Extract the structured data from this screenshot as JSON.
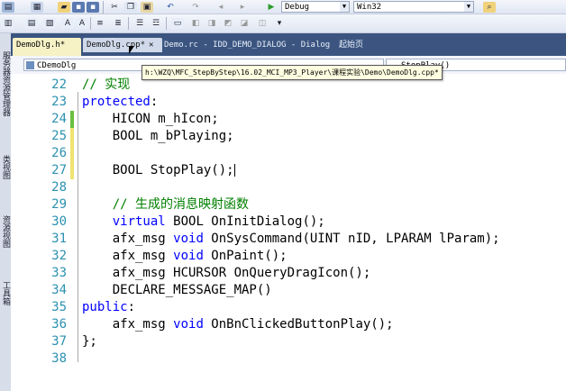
{
  "toolbar": {
    "config_value": "Debug",
    "platform_value": "Win32"
  },
  "sidebar": {
    "tabs": [
      "服务器资源管理器",
      "类视图",
      "资源视图",
      "工具箱"
    ]
  },
  "tabs": [
    {
      "label": "DemoDlg.h*",
      "state": "active"
    },
    {
      "label": "DemoDlg.cpp*",
      "state": "inactive2"
    },
    {
      "label": "Demo.rc - IDD_DEMO_DIALOG - Dialog",
      "state": "inactive"
    },
    {
      "label": "起始页",
      "state": "inactive"
    }
  ],
  "navbar": {
    "class_combo": "CDemoDlg",
    "member_combo": "StopPlay()"
  },
  "tooltip": "h:\\WZQ\\MFC_StepByStep\\16.02_MCI_MP3_Player\\课程实验\\Demo\\DemoDlg.cpp*",
  "editor": {
    "lines": [
      {
        "num": "22",
        "text": "// 实现",
        "change": ""
      },
      {
        "num": "23",
        "text": "protected:",
        "change": ""
      },
      {
        "num": "24",
        "text": "    HICON m_hIcon;",
        "change": "green"
      },
      {
        "num": "25",
        "text": "    BOOL m_bPlaying;",
        "change": "yellow"
      },
      {
        "num": "26",
        "text": "",
        "change": "yellow"
      },
      {
        "num": "27",
        "text": "    BOOL StopPlay();",
        "change": "yellow"
      },
      {
        "num": "28",
        "text": "",
        "change": ""
      },
      {
        "num": "29",
        "text": "    // 生成的消息映射函数",
        "change": ""
      },
      {
        "num": "30",
        "text": "    virtual BOOL OnInitDialog();",
        "change": ""
      },
      {
        "num": "31",
        "text": "    afx_msg void OnSysCommand(UINT nID, LPARAM lParam);",
        "change": ""
      },
      {
        "num": "32",
        "text": "    afx_msg void OnPaint();",
        "change": ""
      },
      {
        "num": "33",
        "text": "    afx_msg HCURSOR OnQueryDragIcon();",
        "change": ""
      },
      {
        "num": "34",
        "text": "    DECLARE_MESSAGE_MAP()",
        "change": ""
      },
      {
        "num": "35",
        "text": "public:",
        "change": ""
      },
      {
        "num": "36",
        "text": "    afx_msg void OnBnClickedButtonPlay();",
        "change": ""
      },
      {
        "num": "37",
        "text": "};",
        "change": ""
      },
      {
        "num": "38",
        "text": "",
        "change": ""
      }
    ]
  },
  "colors": {
    "keyword": "#0000ff",
    "comment": "#008000",
    "line_number": "#2b91af",
    "tab_bar": "#3b5580"
  }
}
